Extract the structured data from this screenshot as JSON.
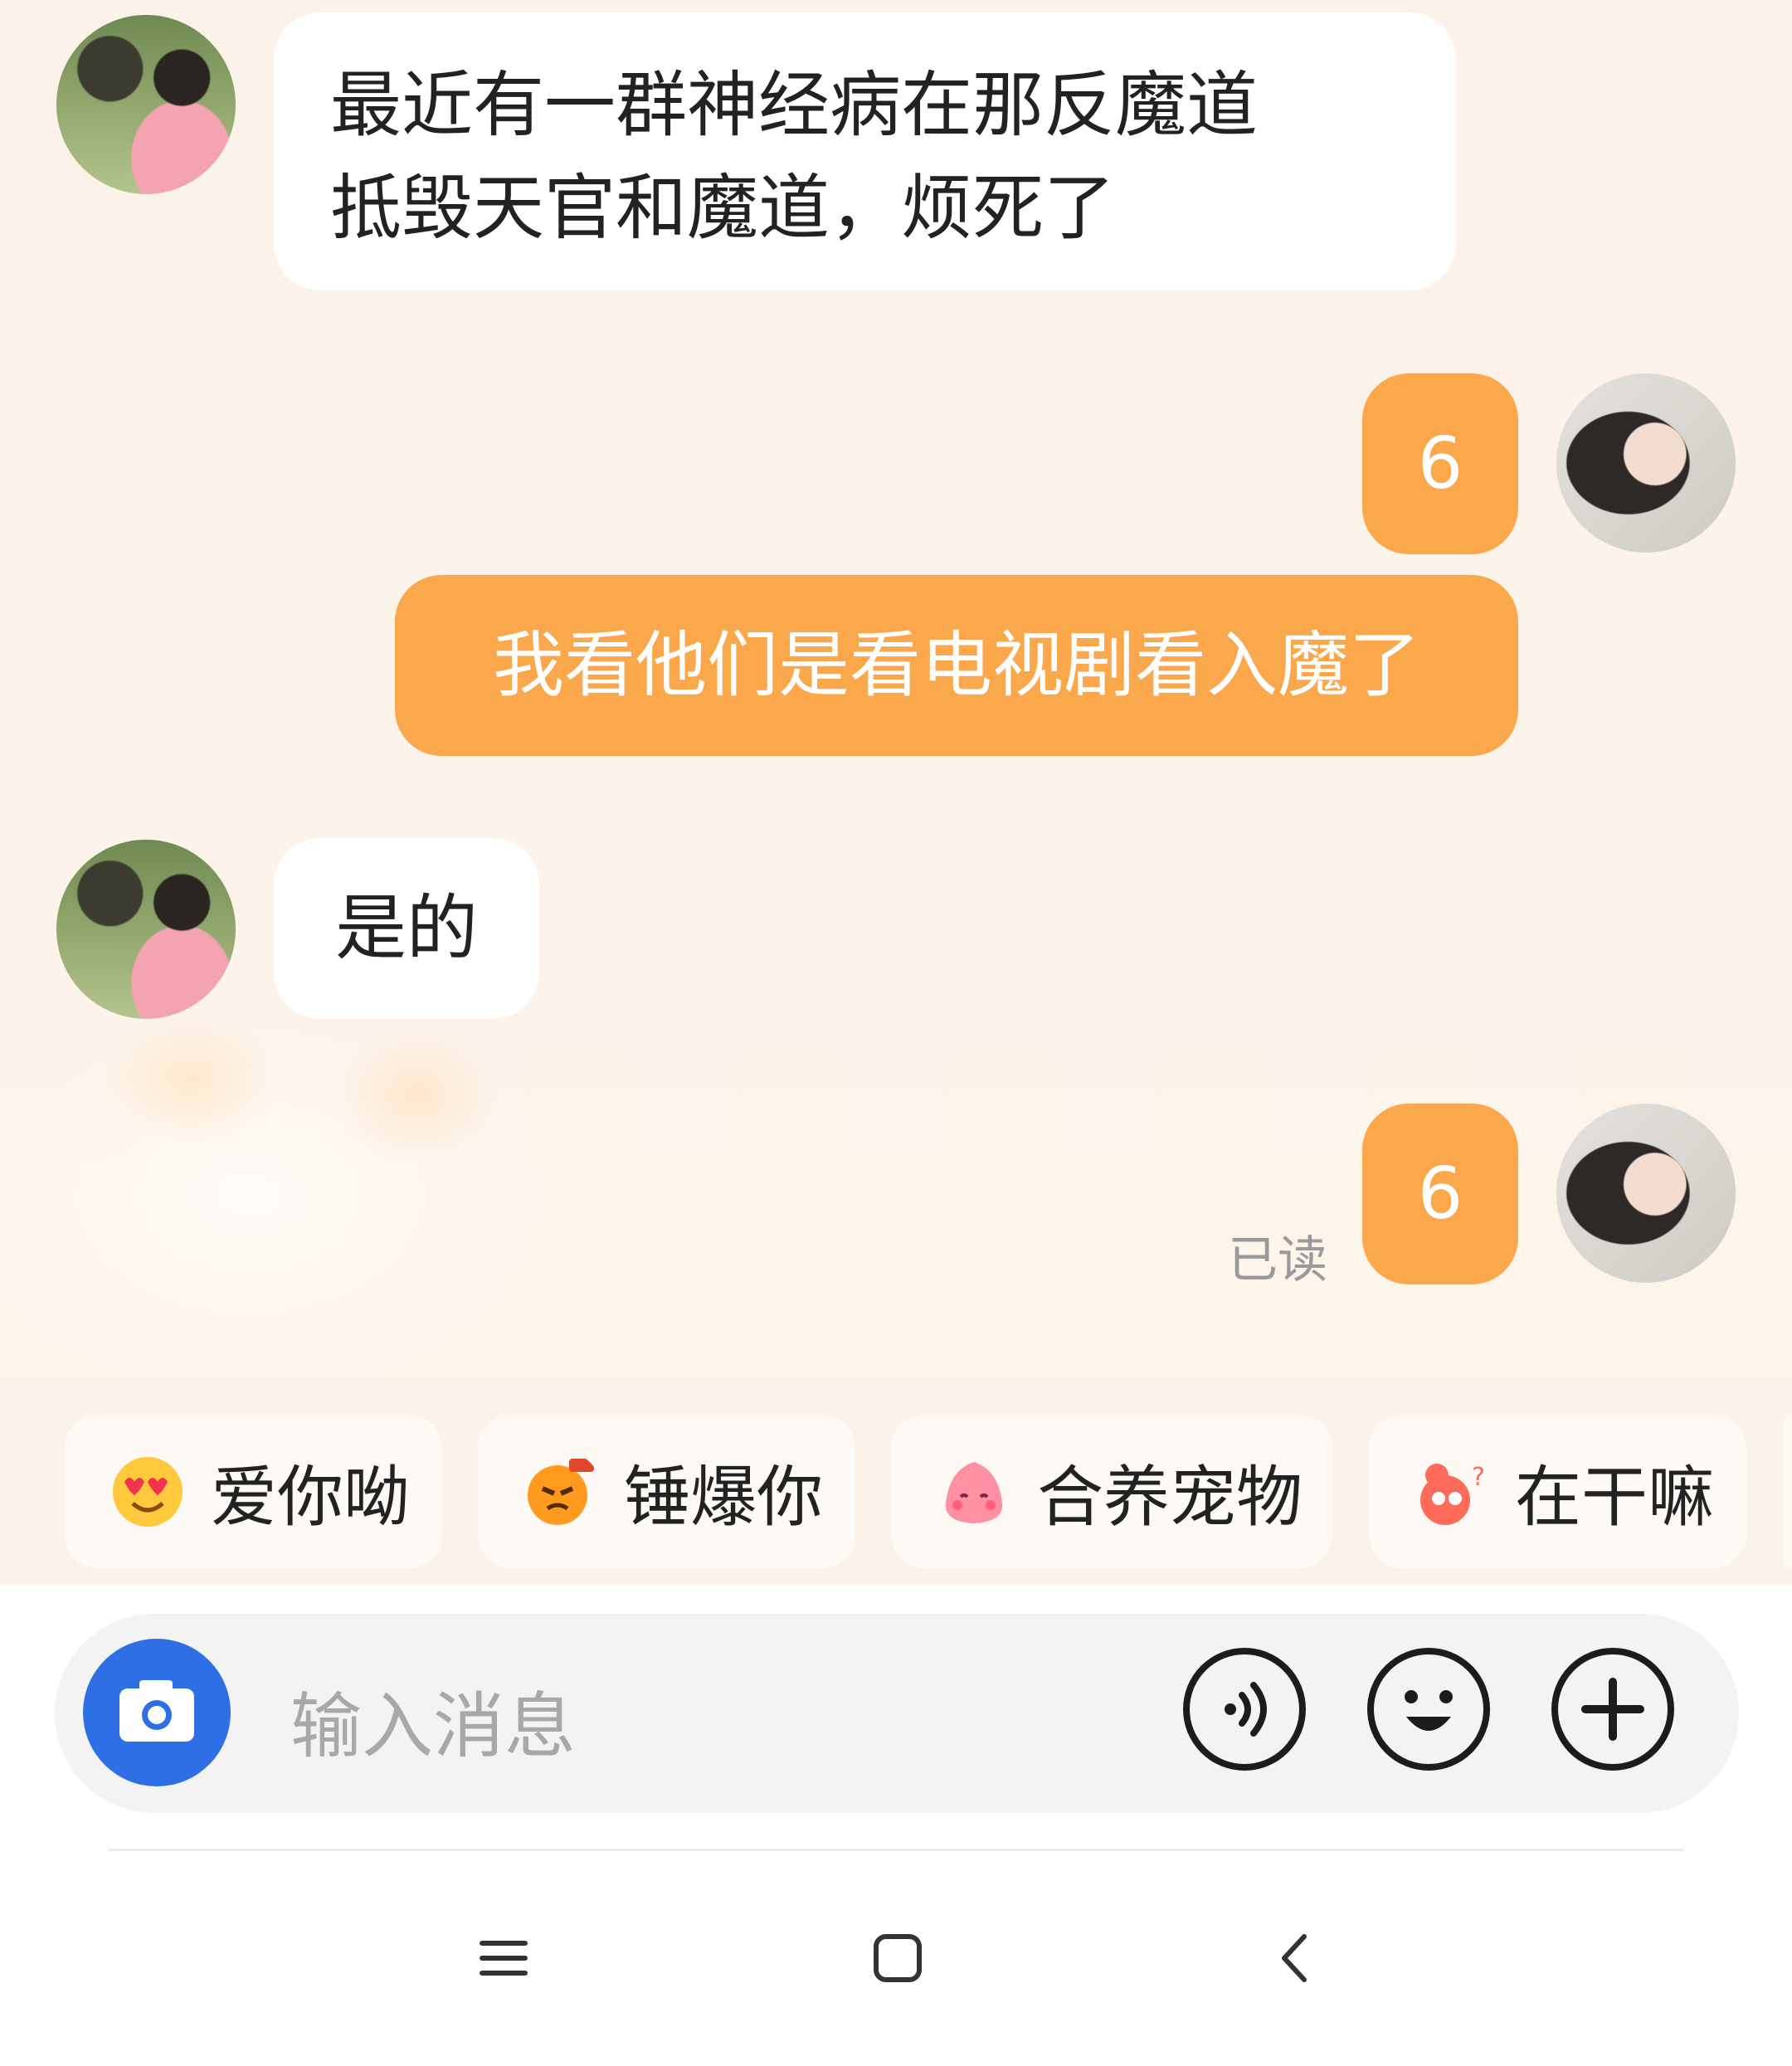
{
  "messages": [
    {
      "side": "in",
      "text_line1": "最近有一群神经病在那反魔道",
      "text_line2": "抵毁天官和魔道，烦死了"
    },
    {
      "side": "out",
      "text": "6"
    },
    {
      "side": "out",
      "text": "我看他们是看电视剧看入魔了"
    },
    {
      "side": "in",
      "text": "是的"
    },
    {
      "side": "out",
      "text": "6"
    }
  ],
  "read_status": "已读",
  "quick_replies": [
    {
      "label": "爱你呦",
      "icon": "heart-eyes-emoji-icon"
    },
    {
      "label": "锤爆你",
      "icon": "angry-hammer-emoji-icon"
    },
    {
      "label": "合养宠物",
      "icon": "pink-pet-icon"
    },
    {
      "label": "在干嘛",
      "icon": "curious-mascot-icon"
    }
  ],
  "input": {
    "placeholder": "输入消息"
  },
  "buttons": {
    "camera": "camera-icon",
    "voice": "voice-icon",
    "emoji": "smiley-icon",
    "plus": "plus-icon"
  },
  "colors": {
    "accent_orange": "#fba74b",
    "camera_blue": "#2f6fe6",
    "incoming_bubble": "#ffffff"
  }
}
